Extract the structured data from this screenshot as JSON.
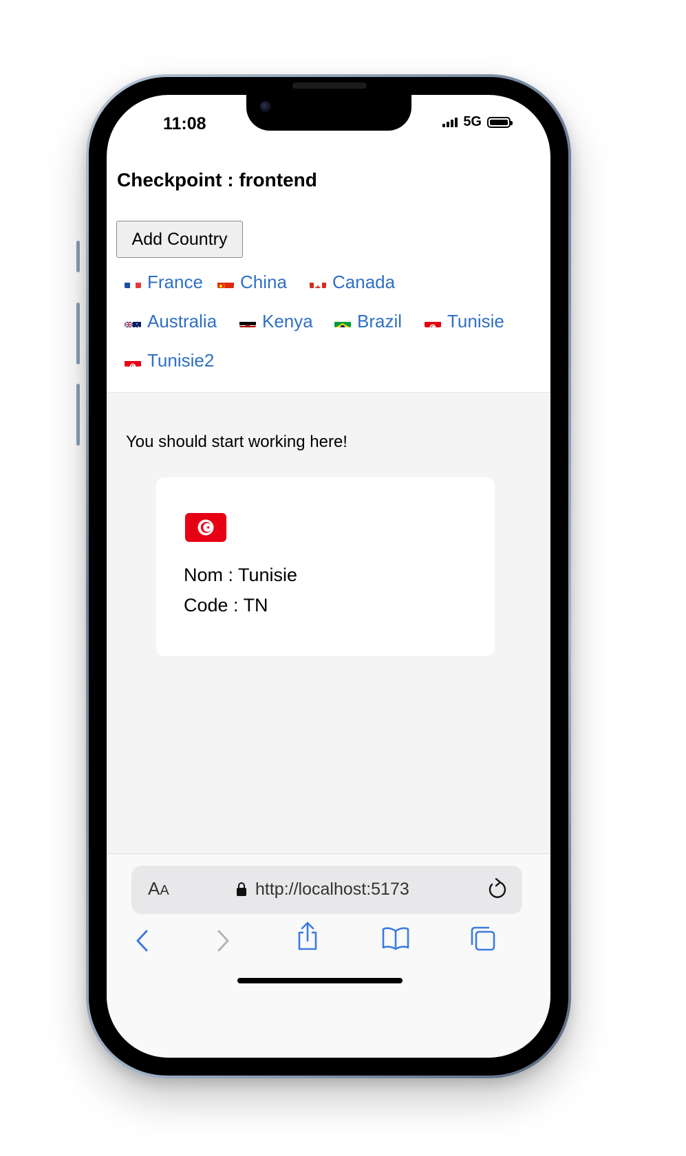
{
  "status_bar": {
    "time": "11:08",
    "network": "5G"
  },
  "page": {
    "heading": "Checkpoint : frontend",
    "add_button_label": "Add Country",
    "countries": [
      {
        "label": "France",
        "flag": "fr"
      },
      {
        "label": "China",
        "flag": "cn"
      },
      {
        "label": "Canada",
        "flag": "ca"
      },
      {
        "label": "Australia",
        "flag": "au"
      },
      {
        "label": "Kenya",
        "flag": "ke"
      },
      {
        "label": "Brazil",
        "flag": "br"
      },
      {
        "label": "Tunisie",
        "flag": "tn"
      },
      {
        "label": "Tunisie2",
        "flag": "tn"
      }
    ],
    "intro": "You should start working here!",
    "card": {
      "flag": "tn",
      "name_line": "Nom : Tunisie",
      "code_line": "Code : TN"
    }
  },
  "browser": {
    "text_size_label": "A",
    "text_size_small": "A",
    "url": "http://localhost:5173",
    "icons": [
      "back-icon",
      "forward-icon",
      "share-icon",
      "bookmarks-icon",
      "tabs-icon",
      "reload-icon",
      "lock-icon"
    ]
  },
  "colors": {
    "link": "#2f6fc4",
    "toolbar_icon": "#3a7be0",
    "main_background": "#f4f4f4"
  }
}
